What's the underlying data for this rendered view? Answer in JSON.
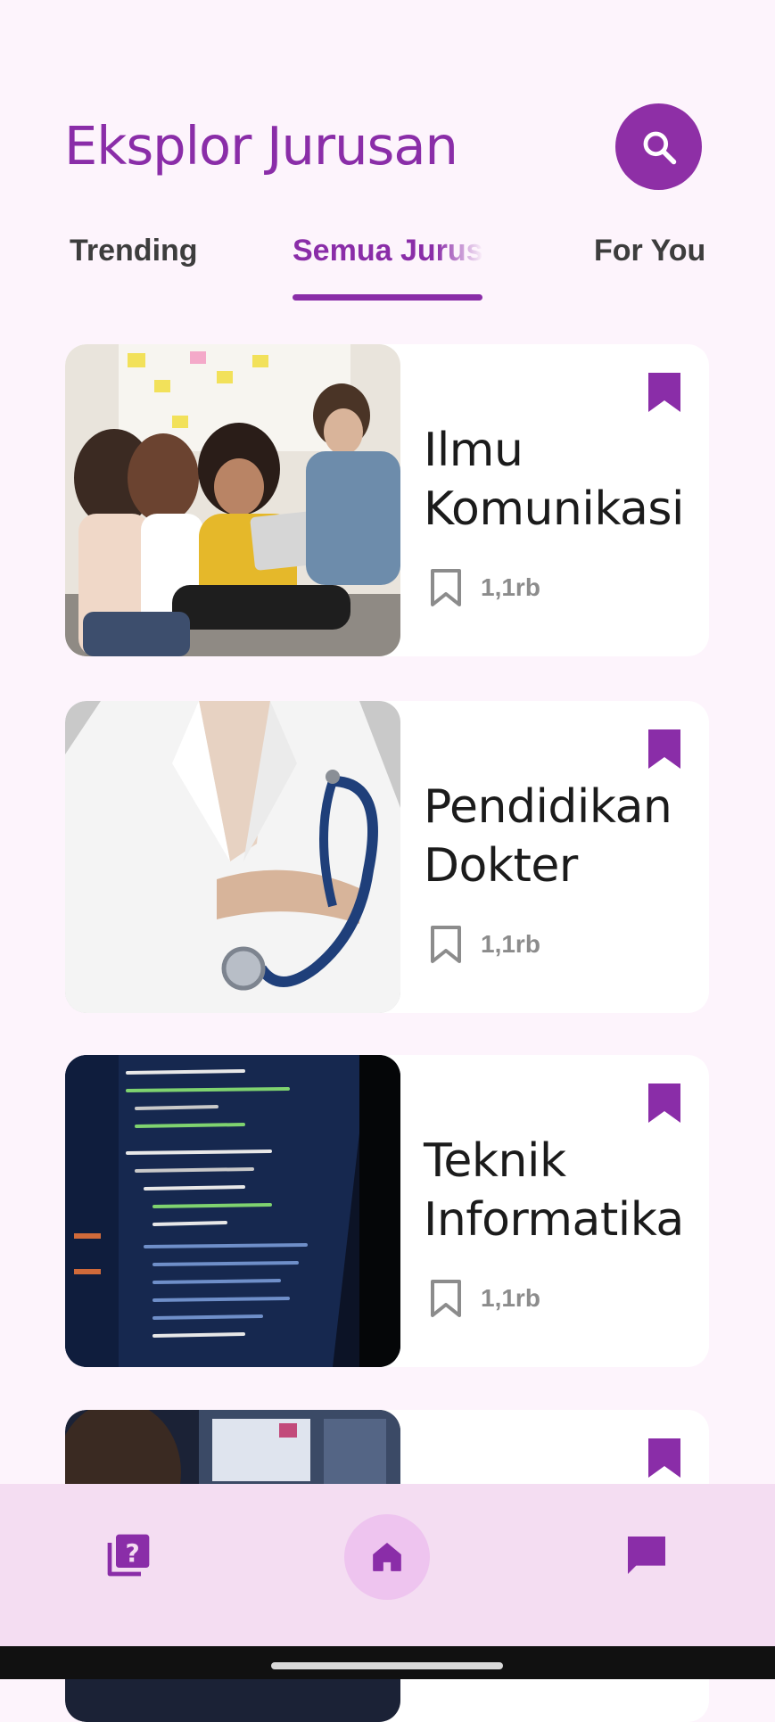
{
  "header": {
    "title": "Eksplor Jurusan",
    "search_icon": "search-icon"
  },
  "tabs": [
    {
      "label": "Trending",
      "active": false
    },
    {
      "label": "Semua Jurusan",
      "active": true
    },
    {
      "label": "For You",
      "active": false
    }
  ],
  "cards": [
    {
      "title": "Ilmu\nKomunikasi",
      "saves": "1,1rb",
      "image": "students-group-photo",
      "bookmarked": true
    },
    {
      "title": "Pendidikan\nDokter",
      "saves": "1,1rb",
      "image": "doctor-stethoscope-photo",
      "bookmarked": true
    },
    {
      "title": "Teknik\nInformatika",
      "saves": "1,1rb",
      "image": "code-on-screen-photo",
      "bookmarked": true
    },
    {
      "title": "",
      "saves": "",
      "image": "developer-monitor-photo",
      "bookmarked": true
    }
  ],
  "bottom_nav": {
    "items": [
      {
        "icon": "quiz-icon",
        "active": false
      },
      {
        "icon": "home-icon",
        "active": true
      },
      {
        "icon": "chat-icon",
        "active": false
      }
    ]
  },
  "colors": {
    "accent": "#8a2da8",
    "background": "#fdf4fc",
    "nav_background": "#f4ddf2",
    "nav_active_indicator": "#eec4ef"
  }
}
